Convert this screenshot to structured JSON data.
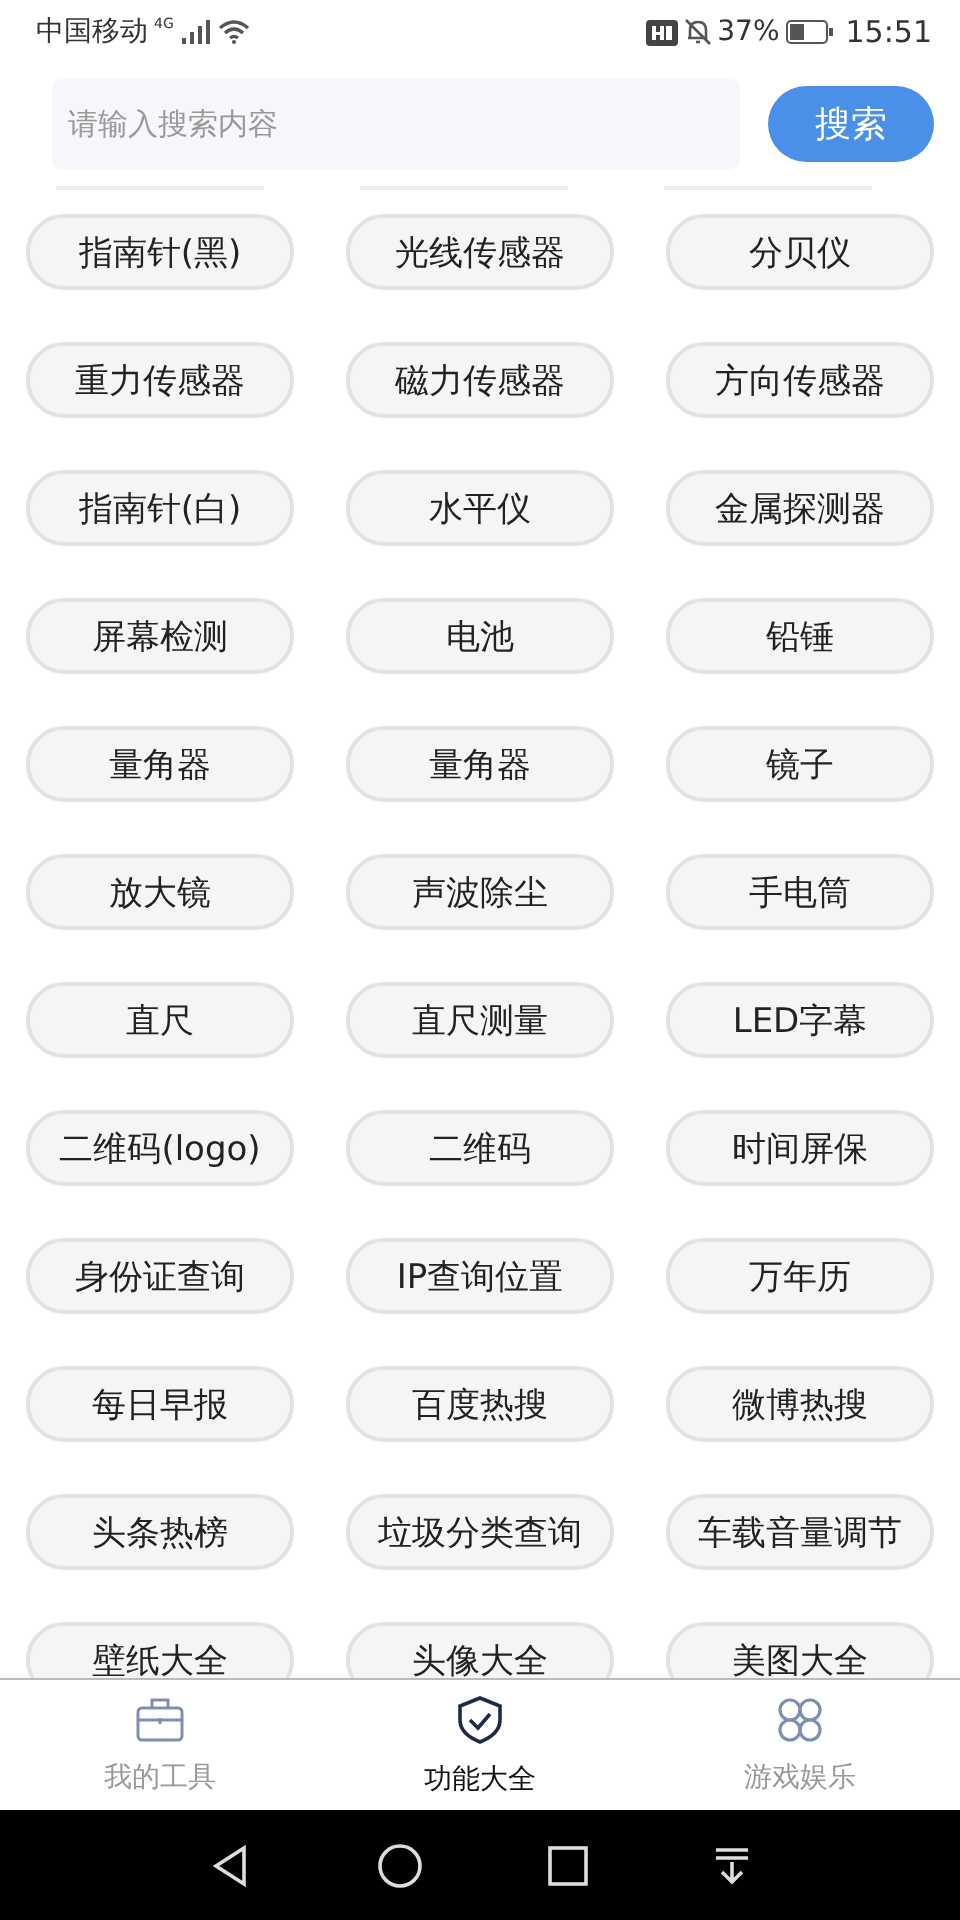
{
  "status_bar": {
    "carrier": "中国移动",
    "network": "4G",
    "battery_percent": "37%",
    "time": "15:51"
  },
  "search": {
    "placeholder": "请输入搜索内容",
    "button": "搜索"
  },
  "tools": [
    "指南针(黑)",
    "光线传感器",
    "分贝仪",
    "重力传感器",
    "磁力传感器",
    "方向传感器",
    "指南针(白)",
    "水平仪",
    "金属探测器",
    "屏幕检测",
    "电池",
    "铅锤",
    "量角器",
    "量角器",
    "镜子",
    "放大镜",
    "声波除尘",
    "手电筒",
    "直尺",
    "直尺测量",
    "LED字幕",
    "二维码(logo)",
    "二维码",
    "时间屏保",
    "身份证查询",
    "IP查询位置",
    "万年历",
    "每日早报",
    "百度热搜",
    "微博热搜",
    "头条热榜",
    "垃圾分类查询",
    "车载音量调节",
    "壁纸大全",
    "头像大全",
    "美图大全"
  ],
  "tabs": [
    {
      "kind": "toolbox",
      "label": "我的工具",
      "selected": false
    },
    {
      "kind": "shield",
      "label": "功能大全",
      "selected": true
    },
    {
      "kind": "grid",
      "label": "游戏娱乐",
      "selected": false
    }
  ]
}
